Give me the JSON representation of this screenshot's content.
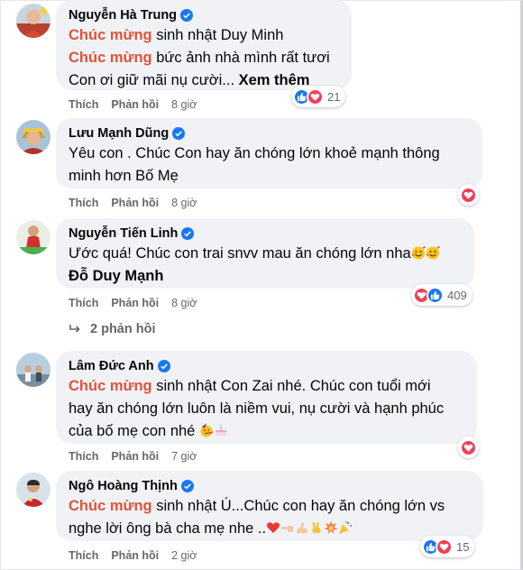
{
  "actions": {
    "like": "Thích",
    "reply": "Phản hồi"
  },
  "colors": {
    "tag": "#e0533a",
    "like_blue": "#1877f2",
    "love_red": "#f33e58",
    "meta_gray": "#65676b",
    "bubble_bg": "#f0f2f5"
  },
  "comments": [
    {
      "name": "Nguyễn Hà Trung",
      "l1_tag": "Chúc mừng",
      "l1_rest": " sinh nhật Duy Minh",
      "l2_tag": "Chúc mừng",
      "l2_rest": " bức ảnh nhà mình rất tươi",
      "l3_text": "Con ơi giữ mãi nụ cười... ",
      "l3_more": "Xem thêm",
      "time": "8 giờ",
      "reaction_count": "21",
      "reaction_icons": [
        "like-icon",
        "love-icon"
      ]
    },
    {
      "name": "Lưu Mạnh Dũng",
      "l1": "Yêu con . Chúc Con hay ăn chóng lớn khoẻ mạnh thông",
      "l2": "minh hơn Bố Mẹ",
      "time": "8 giờ",
      "reaction_icons": [
        "love-icon"
      ]
    },
    {
      "name": "Nguyễn Tiến Linh",
      "l1": "Ước quá! Chúc con trai snvv mau ăn chóng lớn nha",
      "l2": "Đỗ Duy Mạnh",
      "time": "8 giờ",
      "reaction_count": "409",
      "reaction_icons": [
        "love-icon",
        "like-icon"
      ],
      "replies": "2 phản hồi"
    },
    {
      "name": "Lâm Đức Anh",
      "l1_tag": "Chúc mừng",
      "l1_rest": " sinh nhật Con Zai nhé. Chúc con tuổi mới",
      "l2": "hay ăn chóng lớn luôn là niềm vui, nụ cười và hạnh phúc",
      "l3": "của bố mẹ con nhé",
      "time": "7 giờ",
      "reaction_icons": [
        "love-icon"
      ]
    },
    {
      "name": "Ngô Hoàng Thịnh",
      "l1_tag": "Chúc mừng",
      "l1_rest": " sinh nhật Ú...Chúc con hay ăn chóng lớn vs",
      "l2": "nghe lời ông bà cha mẹ nhe ..",
      "time": "2 giờ",
      "reaction_count": "15",
      "reaction_icons": [
        "like-icon",
        "love-icon"
      ]
    }
  ]
}
